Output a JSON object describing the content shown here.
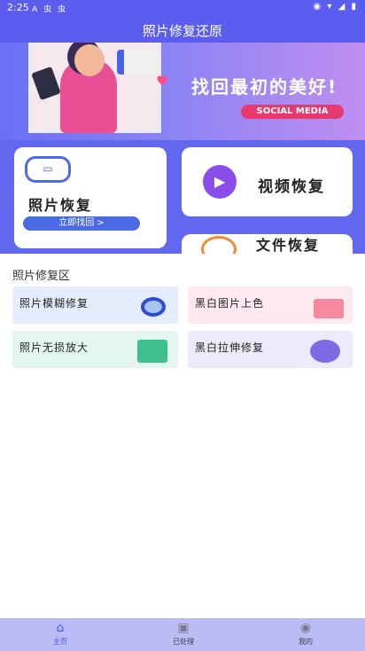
{
  "status_bar": {
    "time": "2:25",
    "left_icons": "A 虫 虫",
    "right_icons": "◉ ▾ ◢ ▮"
  },
  "header": {
    "title": "照片修复还原"
  },
  "banner": {
    "slogan": "找回最初的美好!",
    "tag": "SOCIAL MEDIA"
  },
  "features": {
    "photo": {
      "label": "照片恢复",
      "button": "立即找回 >"
    },
    "video": {
      "label": "视频恢复"
    },
    "file": {
      "label": "文件恢复"
    }
  },
  "repair_section": {
    "title": "照片修复区",
    "tiles": [
      {
        "label": "照片模糊修复",
        "icon": "magnifier-icon"
      },
      {
        "label": "黑白图片上色",
        "icon": "pencil-note-icon"
      },
      {
        "label": "照片无损放大",
        "icon": "enlarge-icon"
      },
      {
        "label": "黑白拉伸修复",
        "icon": "gear-icon"
      }
    ]
  },
  "bottom_nav": {
    "items": [
      {
        "label": "主页",
        "icon": "home-icon",
        "active": true
      },
      {
        "label": "已处理",
        "icon": "processed-icon",
        "active": false
      },
      {
        "label": "我的",
        "icon": "profile-icon",
        "active": false
      }
    ]
  },
  "colors": {
    "primary": "#5b5cf0",
    "accent": "#4a6ae6",
    "nav_bg": "#bbbcf4"
  }
}
